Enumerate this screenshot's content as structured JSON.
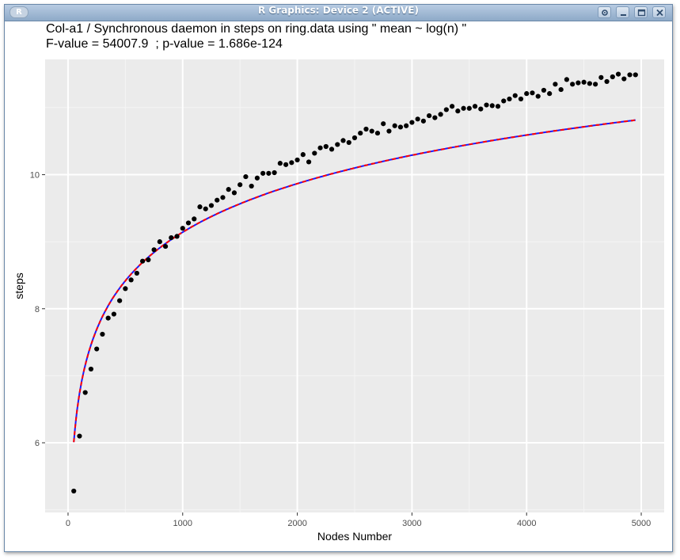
{
  "window": {
    "title": "R Graphics: Device 2 (ACTIVE)",
    "app_icon_label": "R",
    "controls": [
      "options-icon",
      "minimize-icon",
      "maximize-icon",
      "close-icon"
    ]
  },
  "chart_data": {
    "type": "scatter",
    "title": "Col-a1 / Synchronous daemon in steps on ring.data using \" mean ~ log(n) \"",
    "subtitle": "F-value = 54007.9  ; p-value = 1.686e-124",
    "xlabel": "Nodes Number",
    "ylabel": "steps",
    "xlim": [
      -200,
      5200
    ],
    "ylim": [
      4.96,
      11.72
    ],
    "x_ticks": [
      0,
      1000,
      2000,
      3000,
      4000,
      5000
    ],
    "y_ticks": [
      6,
      8,
      10
    ],
    "grid": true,
    "background": "#ebebeb",
    "series": [
      {
        "kind": "points",
        "color": "#000000",
        "x": [
          50,
          100,
          150,
          200,
          250,
          300,
          350,
          400,
          450,
          500,
          550,
          600,
          650,
          700,
          750,
          800,
          850,
          900,
          950,
          1000,
          1050,
          1100,
          1150,
          1200,
          1250,
          1300,
          1350,
          1400,
          1450,
          1500,
          1550,
          1600,
          1650,
          1700,
          1750,
          1800,
          1850,
          1900,
          1950,
          2000,
          2050,
          2100,
          2150,
          2200,
          2250,
          2300,
          2350,
          2400,
          2450,
          2500,
          2550,
          2600,
          2650,
          2700,
          2750,
          2800,
          2850,
          2900,
          2950,
          3000,
          3050,
          3100,
          3150,
          3200,
          3250,
          3300,
          3350,
          3400,
          3450,
          3500,
          3550,
          3600,
          3650,
          3700,
          3750,
          3800,
          3850,
          3900,
          3950,
          4000,
          4050,
          4100,
          4150,
          4200,
          4250,
          4300,
          4350,
          4400,
          4450,
          4500,
          4550,
          4600,
          4650,
          4700,
          4750,
          4800,
          4850,
          4900,
          4950
        ],
        "y": [
          5.28,
          6.1,
          6.75,
          7.1,
          7.4,
          7.62,
          7.86,
          7.92,
          8.12,
          8.3,
          8.43,
          8.53,
          8.71,
          8.73,
          8.88,
          9.0,
          8.93,
          9.06,
          9.08,
          9.2,
          9.28,
          9.34,
          9.52,
          9.49,
          9.54,
          9.62,
          9.66,
          9.78,
          9.73,
          9.85,
          9.97,
          9.83,
          9.95,
          10.02,
          10.02,
          10.03,
          10.17,
          10.15,
          10.18,
          10.22,
          10.3,
          10.19,
          10.32,
          10.4,
          10.42,
          10.38,
          10.45,
          10.51,
          10.48,
          10.55,
          10.62,
          10.68,
          10.65,
          10.62,
          10.76,
          10.65,
          10.73,
          10.71,
          10.73,
          10.78,
          10.83,
          10.8,
          10.88,
          10.85,
          10.9,
          10.97,
          11.02,
          10.95,
          10.99,
          10.99,
          11.02,
          10.98,
          11.04,
          11.03,
          11.02,
          11.1,
          11.13,
          11.18,
          11.13,
          11.21,
          11.22,
          11.17,
          11.26,
          11.21,
          11.35,
          11.27,
          11.42,
          11.35,
          11.37,
          11.38,
          11.36,
          11.35,
          11.45,
          11.39,
          11.46,
          11.5,
          11.43,
          11.49,
          11.49
        ]
      },
      {
        "kind": "fit-line",
        "color": "#ff0000",
        "dash": true,
        "model": "mean ~ log(n)",
        "a": 1.92,
        "b": 1.0455
      },
      {
        "kind": "fit-line",
        "color": "#1a1aff",
        "dash": false,
        "model": "mean ~ log(n)",
        "a": 1.92,
        "b": 1.0455
      }
    ]
  }
}
